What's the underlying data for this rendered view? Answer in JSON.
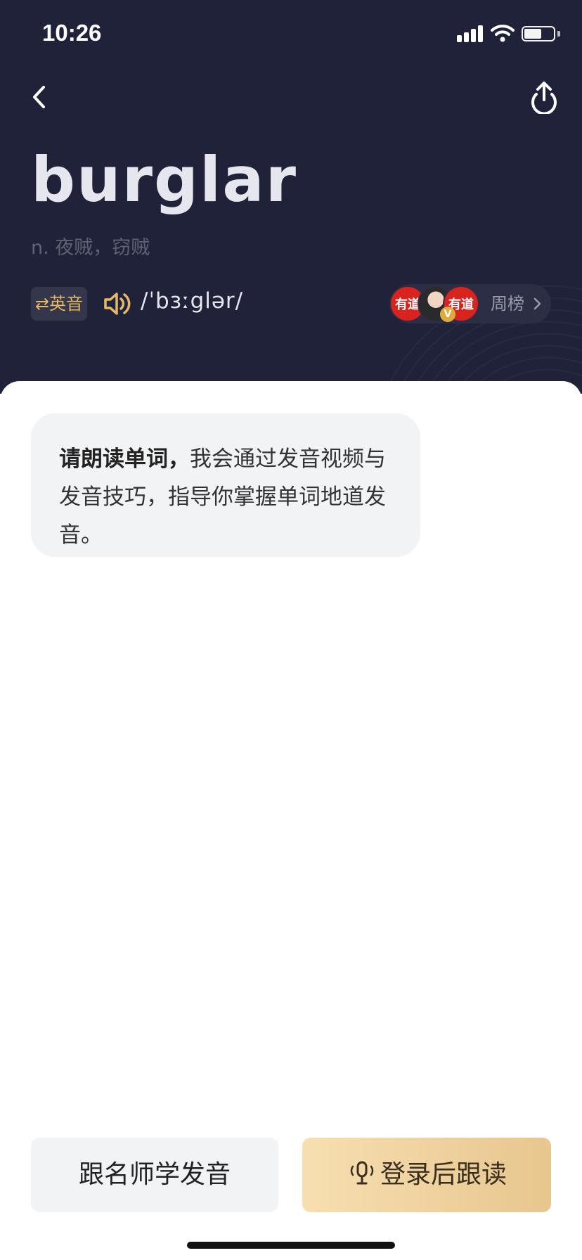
{
  "status_bar": {
    "time": "10:26"
  },
  "word": {
    "headword": "burglar",
    "definition": "n. 夜贼，窃贼",
    "accent_label": "⇄英音",
    "phonetic": "/ˈbɜːglər/"
  },
  "weekly_rank": {
    "logo_text": "有道",
    "badge": "V",
    "label": "周榜"
  },
  "prompt": {
    "bold_text": "请朗读单词，",
    "text": "我会通过发音视频与发音技巧，指导你掌握单词地道发音。"
  },
  "actions": {
    "teacher_label": "跟名师学发音",
    "read_label": "登录后跟读"
  },
  "colors": {
    "header_bg": "#20223a",
    "accent_gold": "#e7b866",
    "bubble_bg": "#f2f3f5",
    "primary_button_start": "#f7dfb1",
    "primary_button_end": "#e8c68e"
  },
  "icons": {
    "back": "chevron-left-icon",
    "share": "share-icon",
    "speaker": "speaker-icon",
    "mic": "mic-icon"
  }
}
